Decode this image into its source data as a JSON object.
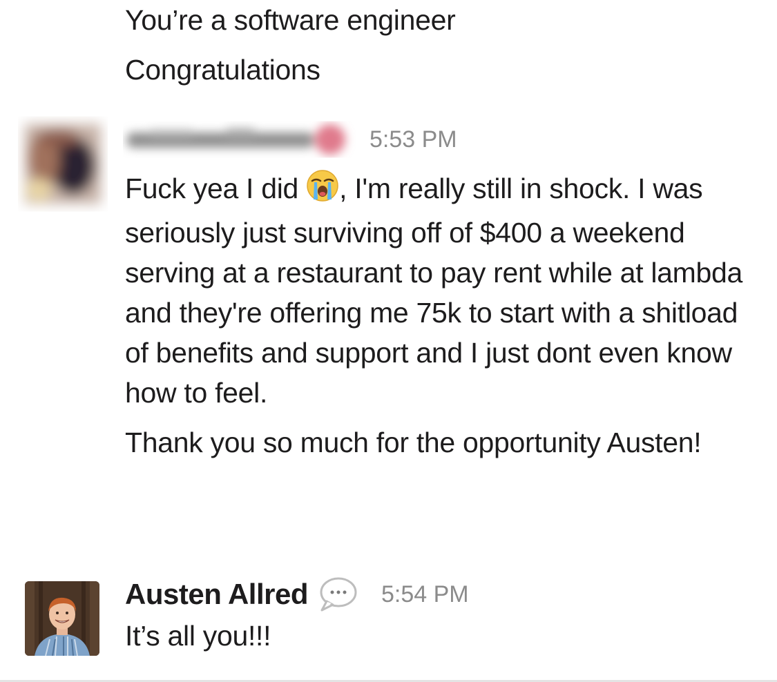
{
  "previous_message": {
    "lines": [
      "You’re a software engineer",
      "Congratulations"
    ]
  },
  "message_1": {
    "time": "5:53 PM",
    "first_fragment": "Fuck yea I did ",
    "emoji": "loudly-crying-face-emoji",
    "paragraph_1_rest": ", I'm really still in shock. I was seriously just surviving off of $400 a weekend serving at a restaurant to pay rent while at lambda and they're offering me 75k to start with a shitload of benefits and support and I just dont even know how to feel.",
    "paragraph_2": "Thank you so much for the opportunity Austen!"
  },
  "message_2": {
    "author": "Austen Allred",
    "status_icon": "speech-bubble-icon",
    "time": "5:54 PM",
    "text": "It’s all you!!!"
  },
  "colors": {
    "text": "#1d1c1d",
    "timestamp": "#8b8b8b",
    "background": "#ffffff"
  }
}
